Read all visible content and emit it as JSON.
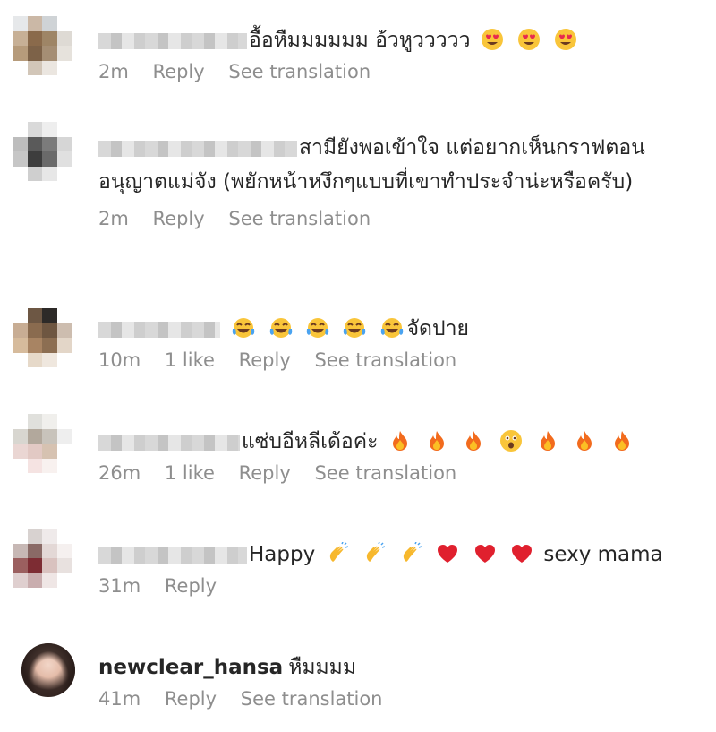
{
  "comments": [
    {
      "text": "อื้อหืมมมมมม อ้วหูววววว",
      "emojis": [
        "heart-eyes-icon",
        "heart-eyes-icon",
        "heart-eyes-icon"
      ],
      "time": "2m",
      "reply": "Reply",
      "translation": "See translation"
    },
    {
      "text": "สามียังพอเข้าใจ แต่อยากเห็นกราฟตอนอนุญาตแม่จัง (พยักหน้าหงึกๆแบบที่เขาทำประจำน่ะหรือครับ)",
      "time": "2m",
      "reply": "Reply",
      "translation": "See translation"
    },
    {
      "text_after": "จัดปาย",
      "emojis": [
        "tears-of-joy-icon",
        "tears-of-joy-icon",
        "tears-of-joy-icon",
        "tears-of-joy-icon",
        "tears-of-joy-icon"
      ],
      "time": "10m",
      "likes": "1 like",
      "reply": "Reply",
      "translation": "See translation"
    },
    {
      "text": "แซ่บอีหลีเด้อค่ะ",
      "emojis": [
        "fire-icon",
        "fire-icon",
        "fire-icon",
        "astonished-face-icon",
        "fire-icon",
        "fire-icon",
        "fire-icon"
      ],
      "time": "26m",
      "likes": "1 like",
      "reply": "Reply",
      "translation": "See translation"
    },
    {
      "text": "Happy",
      "emojis": [
        "clapping-hands-icon",
        "clapping-hands-icon",
        "clapping-hands-icon",
        "red-heart-icon",
        "red-heart-icon",
        "red-heart-icon"
      ],
      "text_after": "sexy mama",
      "time": "31m",
      "reply": "Reply"
    },
    {
      "username": "newclear_hansa",
      "text": "หืมมมม",
      "time": "41m",
      "reply": "Reply",
      "translation": "See translation"
    }
  ]
}
